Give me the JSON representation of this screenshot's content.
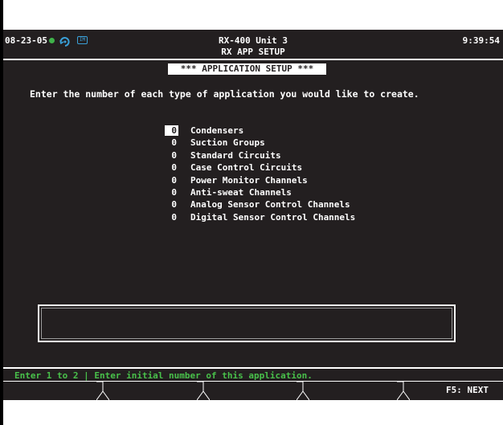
{
  "header": {
    "date": "08-23-05",
    "title": "RX-400 Unit 3",
    "subtitle": "RX APP SETUP",
    "time": "9:39:54",
    "status_icons": [
      "status-dot-icon",
      "refresh-cycle-icon",
      "memory-chip-icon"
    ],
    "status_icon_text": {
      "box": "IM"
    }
  },
  "banner": {
    "label": "*** APPLICATION SETUP ***"
  },
  "instruction": "Enter the number of each type of application you would like to create.",
  "applications": [
    {
      "qty": "0",
      "label": "Condensers",
      "selected": true
    },
    {
      "qty": "0",
      "label": "Suction Groups",
      "selected": false
    },
    {
      "qty": "0",
      "label": "Standard Circuits",
      "selected": false
    },
    {
      "qty": "0",
      "label": "Case Control Circuits",
      "selected": false
    },
    {
      "qty": "0",
      "label": "Power Monitor Channels",
      "selected": false
    },
    {
      "qty": "0",
      "label": "Anti-sweat Channels",
      "selected": false
    },
    {
      "qty": "0",
      "label": "Analog Sensor Control Channels",
      "selected": false
    },
    {
      "qty": "0",
      "label": "Digital Sensor Control Channels",
      "selected": false
    }
  ],
  "message_box": {
    "text": ""
  },
  "help_line": "Enter 1 to 2 | Enter initial number of this application.",
  "function_keys": [
    {
      "label": ""
    },
    {
      "label": ""
    },
    {
      "label": ""
    },
    {
      "label": ""
    },
    {
      "label": "F5: NEXT"
    }
  ],
  "colors": {
    "background": "#231f20",
    "text": "#ffffff",
    "help_text": "#48c04a",
    "status_dot": "#3fb24a",
    "memory_icon": "#3aa0d8"
  }
}
